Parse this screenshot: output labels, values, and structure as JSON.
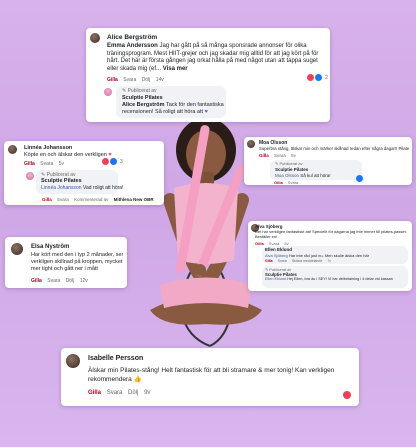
{
  "card1": {
    "author": "Alice Bergström",
    "quoted_author": "Emma Andersson",
    "quoted_text": "Jag har gått på så många sponsrade annonser för olika träningsprogram. Mest HIIT-grejer och jag skadar mig alltid för att jag kört på för hårt. Det här är första gången jag orkat hålla på med något utan att tappa suget eller skada mig  (ef...",
    "view_more": "Visa mer",
    "actions": [
      "Gilla",
      "Svara",
      "Dölj",
      "14v"
    ],
    "reaction_count": "2",
    "reply_prefix": "Publicerat av",
    "reply_brand": "Sculptie Pilates",
    "reply_mention": "Alice Bergström",
    "reply_text": "Tack för den fantastiska recensionen! Så roligt att höra att",
    "reply_actions_label": "Svara"
  },
  "card2": {
    "author": "Linnéa Johansson",
    "text": "Köpte en och älskar den verkligen",
    "actions": [
      "Gilla",
      "Svara",
      "5v"
    ],
    "reaction_count": "3",
    "reply_prefix": "Publicerat av",
    "reply_brand": "Sculptie Pilates",
    "reply_mention": "Linnéa Johansson",
    "reply_text": "Vad roligt att höra!",
    "reply_actions": [
      "Gilla",
      "Svara",
      "Kommenterad av",
      "Mithlena New OBR"
    ]
  },
  "card3": {
    "author": "Moa Olsson",
    "text": "Superbra stång, älskar min och märker skillnad redan efter några dagar!! Pilates är toppen",
    "actions": [
      "Gilla",
      "Svara",
      "5v"
    ],
    "reply_prefix": "Publicerat av",
    "reply_brand": "Sculptie Pilates",
    "reply_mention": "Moa Olsson",
    "reply_text": "Så kul att höra!",
    "reply_actions": [
      "Gilla",
      "Svara"
    ]
  },
  "card4": {
    "author": "Alva Sjöberg",
    "text": "Det har verkligen fantastiskt att! Speciellt för dagarna jag inte hinner till pilates-passet. Beställer en!",
    "actions": [
      "Gilla",
      "Svara",
      "5v"
    ],
    "reply1_author": "Ellen Eklund",
    "reply1_mention": "Alva Sjöberg",
    "reply1_text": "Har inte råd just nu. Men skulle älska den här",
    "reply1_actions": [
      "Gilla",
      "Svara",
      "Skicka meddelande",
      "7v"
    ],
    "reply2_prefix": "Publicerat av",
    "reply2_brand": "Sculptie Pilates",
    "reply2_mention": "Ellen Eklund",
    "reply2_text": "Hej Ellen, bra du i SEY! Vi har delbetalning i 4 delar vid kassan"
  },
  "card5": {
    "author": "Elsa Nyström",
    "text": "Har kört med den i typ 2 månader, ser verkligen skillnad på kroppen, mycket mer tight och gått ner i mått",
    "actions": [
      "Gilla",
      "Svara",
      "Dölj",
      "12v"
    ]
  },
  "card6": {
    "author": "Isabelle Persson",
    "text": "Älskar min Pilates-stång! Helt fantastisk för att bli stramare & mer tonig! Kan verkligen rekommendera",
    "actions": [
      "Gilla",
      "Svara",
      "Dölj",
      "9v"
    ]
  },
  "colors": {
    "background": "#d5aee9",
    "like_red": "#b00020",
    "bar_pink": "#f5a0c4",
    "heart": "#f33e58",
    "thumb": "#1877f2"
  }
}
